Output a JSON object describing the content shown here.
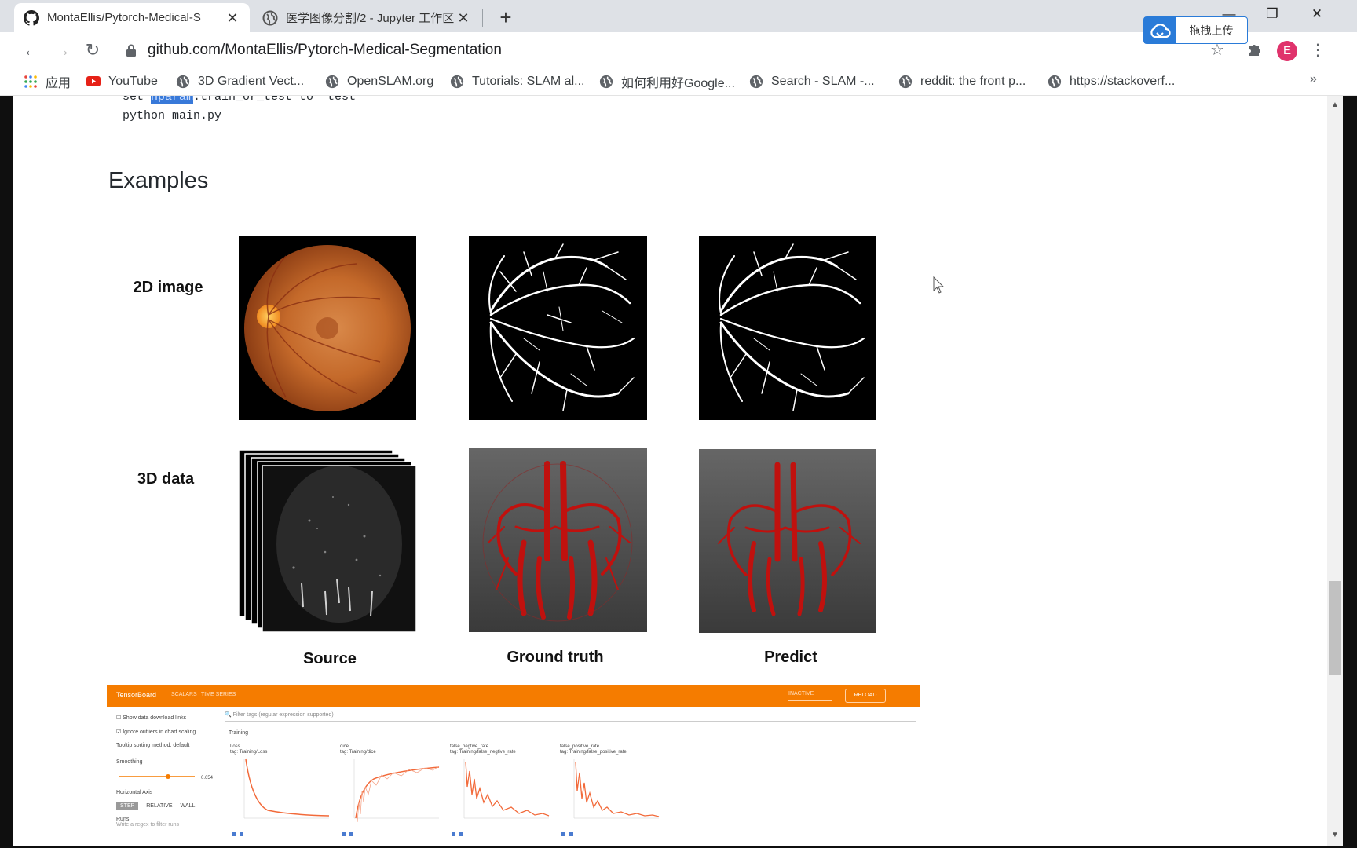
{
  "browser": {
    "tabs": [
      {
        "title": "MontaEllis/Pytorch-Medical-S",
        "active": true
      },
      {
        "title": "医学图像分割/2 - Jupyter 工作区",
        "active": false
      }
    ],
    "url": "github.com/MontaEllis/Pytorch-Medical-Segmentation",
    "avatar_letter": "E",
    "upload_label": "拖拽上传",
    "bookmarks": [
      {
        "label": "应用",
        "icon": "apps-grid-icon"
      },
      {
        "label": "YouTube",
        "icon": "youtube-icon"
      },
      {
        "label": "3D Gradient Vect...",
        "icon": "globe-icon"
      },
      {
        "label": "OpenSLAM.org",
        "icon": "globe-icon"
      },
      {
        "label": "Tutorials: SLAM al...",
        "icon": "globe-icon"
      },
      {
        "label": "如何利用好Google...",
        "icon": "globe-icon"
      },
      {
        "label": "Search - SLAM -...",
        "icon": "globe-icon"
      },
      {
        "label": "reddit: the front p...",
        "icon": "globe-icon"
      },
      {
        "label": "https://stackoverf...",
        "icon": "globe-icon"
      }
    ],
    "more_label": "»"
  },
  "readme": {
    "code_line1_prefix": "set ",
    "code_line1_highlight": "hparam",
    "code_line1_suffix": ".train_or_test to 'test'",
    "code_line2": "python main.py",
    "heading": "Examples",
    "row_labels": [
      "2D image",
      "3D data"
    ],
    "column_labels": [
      "Source",
      "Ground truth",
      "Predict"
    ]
  },
  "tensorboard": {
    "logo": "TensorBoard",
    "tabs": [
      "SCALARS",
      "TIME SERIES"
    ],
    "run_select": "INACTIVE",
    "reload_label": "RELOAD",
    "side": {
      "show_download": "Show data download links",
      "ignore_outliers": "Ignore outliers in chart scaling",
      "tooltip_sorting": "Tooltip sorting method:",
      "tooltip_value": "default",
      "smoothing": "Smoothing",
      "smoothing_value": "0.654",
      "horizontal_axis": "Horizontal Axis",
      "axis_options": [
        "STEP",
        "RELATIVE",
        "WALL"
      ],
      "runs": "Runs",
      "runs_sub": "Write a regex to filter runs"
    },
    "filter_placeholder": "Filter tags (regular expression supported)",
    "section": "Training",
    "cards": [
      {
        "title": "Loss",
        "tag": "tag: Training/Loss",
        "trend": "decay"
      },
      {
        "title": "dice",
        "tag": "tag: Training/dice",
        "trend": "rise"
      },
      {
        "title": "false_negtive_rate",
        "tag": "tag: Training/false_negtive_rate",
        "trend": "decay"
      },
      {
        "title": "false_positive_rate",
        "tag": "tag: Training/false_positive_rate",
        "trend": "decay"
      }
    ]
  },
  "colors": {
    "accent_orange": "#f57c00",
    "chart_line": "#f26a3a",
    "chrome_bg": "#dee1e6",
    "link_blue": "#2a7bd8"
  }
}
